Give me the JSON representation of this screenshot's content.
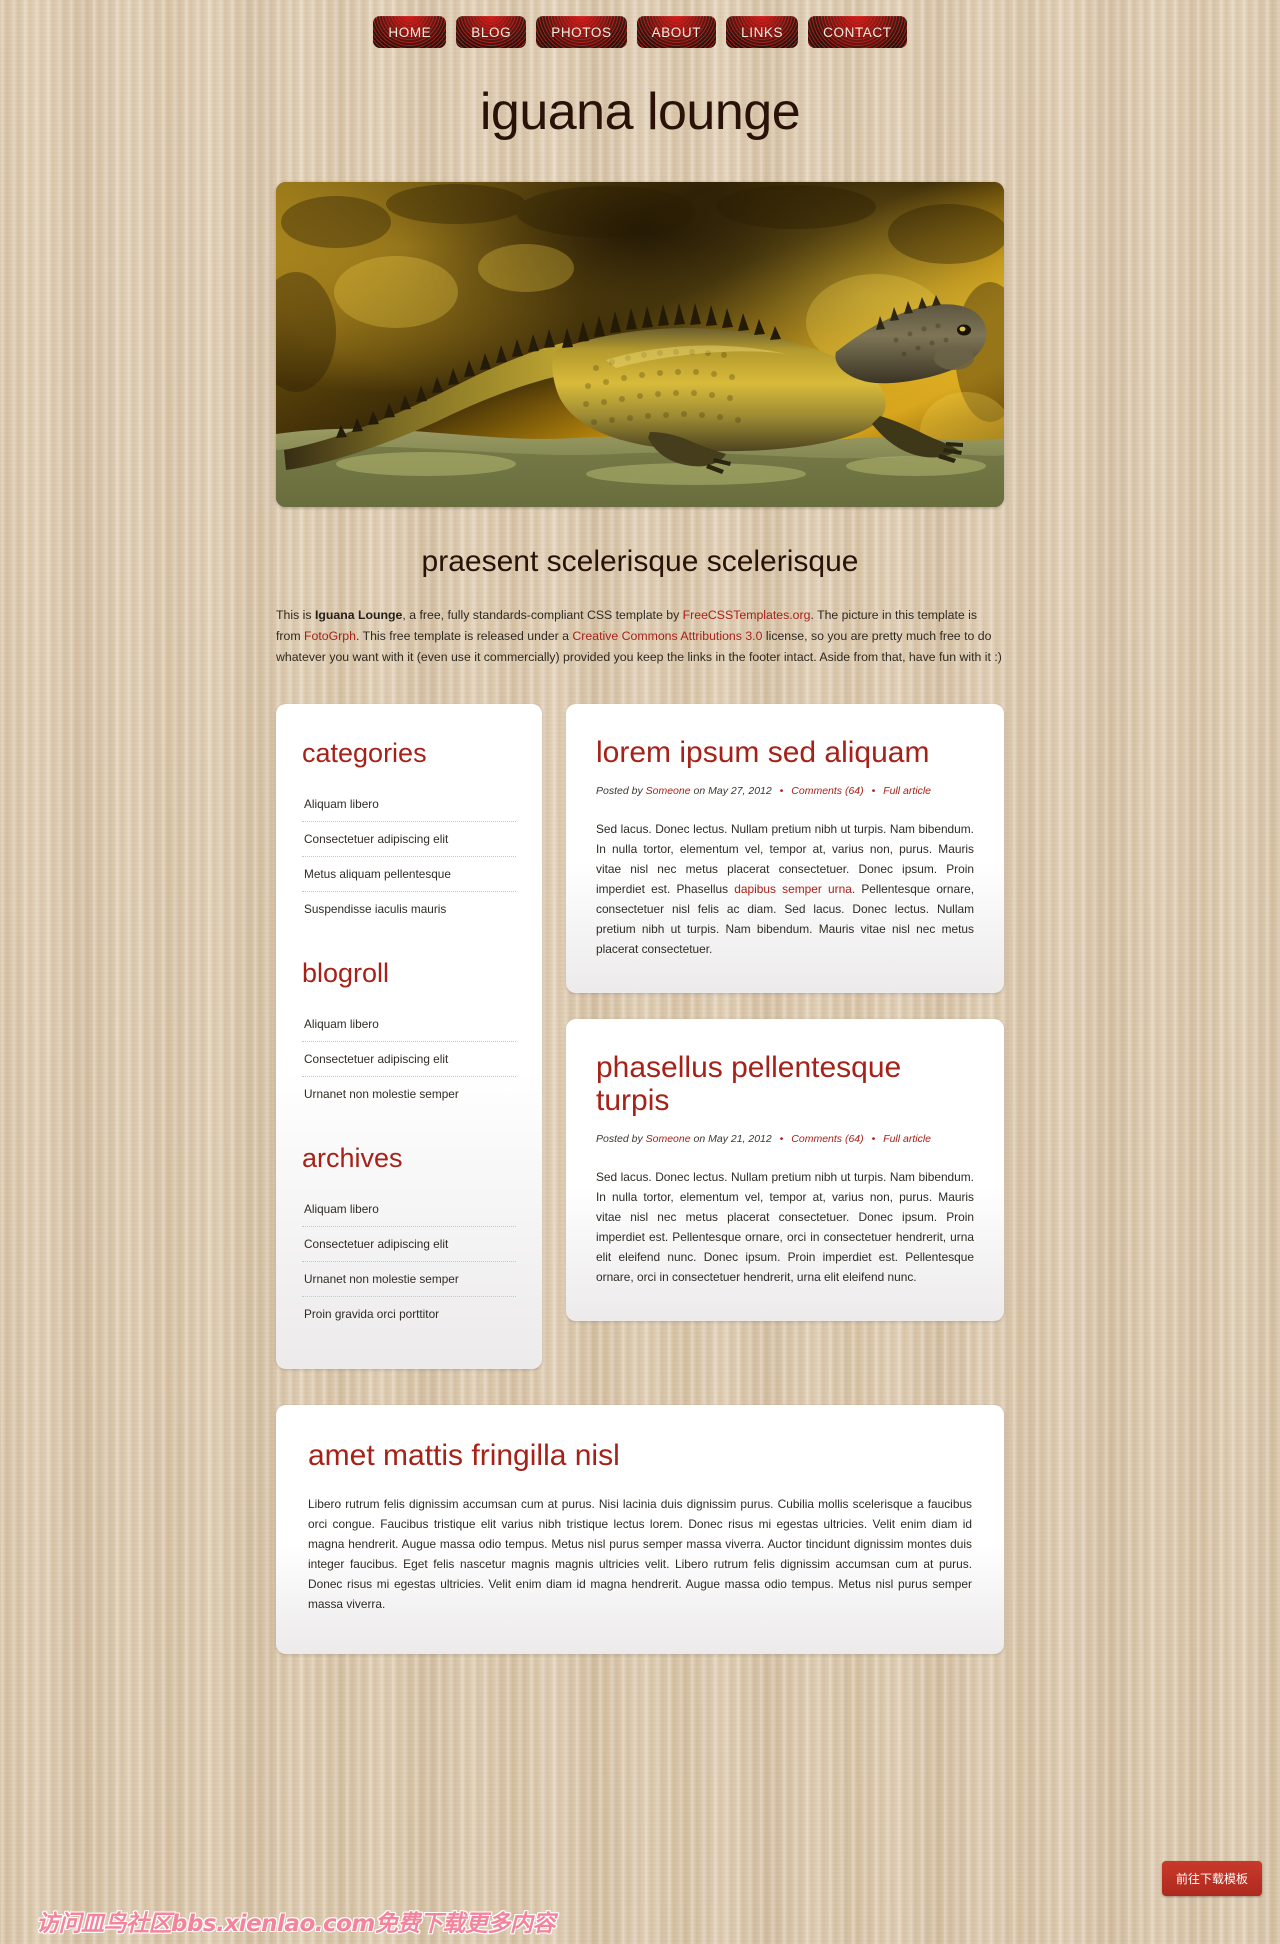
{
  "nav": {
    "items": [
      {
        "label": "HOME"
      },
      {
        "label": "BLOG"
      },
      {
        "label": "PHOTOS"
      },
      {
        "label": "ABOUT"
      },
      {
        "label": "LINKS"
      },
      {
        "label": "CONTACT"
      }
    ]
  },
  "site": {
    "title": "iguana lounge",
    "hero_alt": "iguana-photo"
  },
  "intro": {
    "heading": "praesent scelerisque scelerisque",
    "t1": "This is ",
    "brand": "Iguana Lounge",
    "t2": ", a free, fully standards-compliant CSS template by ",
    "link1": "FreeCSSTemplates.org",
    "t3": ". The picture in this template is from ",
    "link2": "FotoGrph",
    "t4": ". This free template is released under a ",
    "link3": "Creative Commons Attributions 3.0",
    "t5": " license, so you are pretty much free to do whatever you want with it (even use it commercially) provided you keep the links in the footer intact. Aside from that, have fun with it :)"
  },
  "sidebar": {
    "categories": {
      "heading": "categories",
      "items": [
        "Aliquam libero",
        "Consectetuer adipiscing elit",
        "Metus aliquam pellentesque",
        "Suspendisse iaculis mauris"
      ]
    },
    "blogroll": {
      "heading": "blogroll",
      "items": [
        "Aliquam libero",
        "Consectetuer adipiscing elit",
        "Urnanet non molestie semper"
      ]
    },
    "archives": {
      "heading": "archives",
      "items": [
        "Aliquam libero",
        "Consectetuer adipiscing elit",
        "Urnanet non molestie semper",
        "Proin gravida orci porttitor"
      ]
    }
  },
  "posts": [
    {
      "title": "lorem ipsum sed aliquam",
      "meta_posted_by": "Posted by",
      "meta_author": "Someone",
      "meta_on": "on",
      "meta_date": "May 27, 2012",
      "meta_comments": "Comments (64)",
      "meta_full": "Full article",
      "body_a": "Sed lacus. Donec lectus. Nullam pretium nibh ut turpis. Nam bibendum. In nulla tortor, elementum vel, tempor at, varius non, purus. Mauris vitae nisl nec metus placerat consectetuer. Donec ipsum. Proin imperdiet est. Phasellus ",
      "body_link": "dapibus semper urna",
      "body_b": ". Pellentesque ornare, consectetuer nisl felis ac diam. Sed lacus. Donec lectus. Nullam pretium nibh ut turpis. Nam bibendum. Mauris vitae nisl nec metus placerat consectetuer."
    },
    {
      "title": "phasellus pellentesque turpis",
      "meta_posted_by": "Posted by",
      "meta_author": "Someone",
      "meta_on": "on",
      "meta_date": "May 21, 2012",
      "meta_comments": "Comments (64)",
      "meta_full": "Full article",
      "body_a": "Sed lacus. Donec lectus. Nullam pretium nibh ut turpis. Nam bibendum. In nulla tortor, elementum vel, tempor at, varius non, purus. Mauris vitae nisl nec metus placerat consectetuer. Donec ipsum. Proin imperdiet est. Pellentesque ornare, orci in consectetuer hendrerit, urna elit eleifend nunc. Donec ipsum. Proin imperdiet est. Pellentesque ornare, orci in consectetuer hendrerit, urna elit eleifend nunc.",
      "body_link": "",
      "body_b": ""
    }
  ],
  "wide_post": {
    "title": "amet mattis fringilla nisl",
    "body": "Libero rutrum felis dignissim accumsan cum at purus. Nisi lacinia duis dignissim purus. Cubilia mollis scelerisque a faucibus orci congue. Faucibus tristique elit varius nibh tristique lectus lorem. Donec risus mi egestas ultricies. Velit enim diam id magna hendrerit. Augue massa odio tempus. Metus nisl purus semper massa viverra. Auctor tincidunt dignissim montes duis integer faucibus. Eget felis nascetur magnis magnis ultricies velit. Libero rutrum felis dignissim accumsan cum at purus. Donec risus mi egestas ultricies. Velit enim diam id magna hendrerit. Augue massa odio tempus. Metus nisl purus semper massa viverra."
  },
  "overlay": {
    "watermark": "访问皿鸟社区bbs.xienlao.com免费下载更多内容",
    "download_button": "前往下载模板"
  },
  "colors": {
    "accent_red": "#a62218",
    "nav_dark": "#2b1410",
    "paper": "#dbc8ac",
    "watermark_pink": "#f4849c",
    "download_red": "#c0392b"
  }
}
